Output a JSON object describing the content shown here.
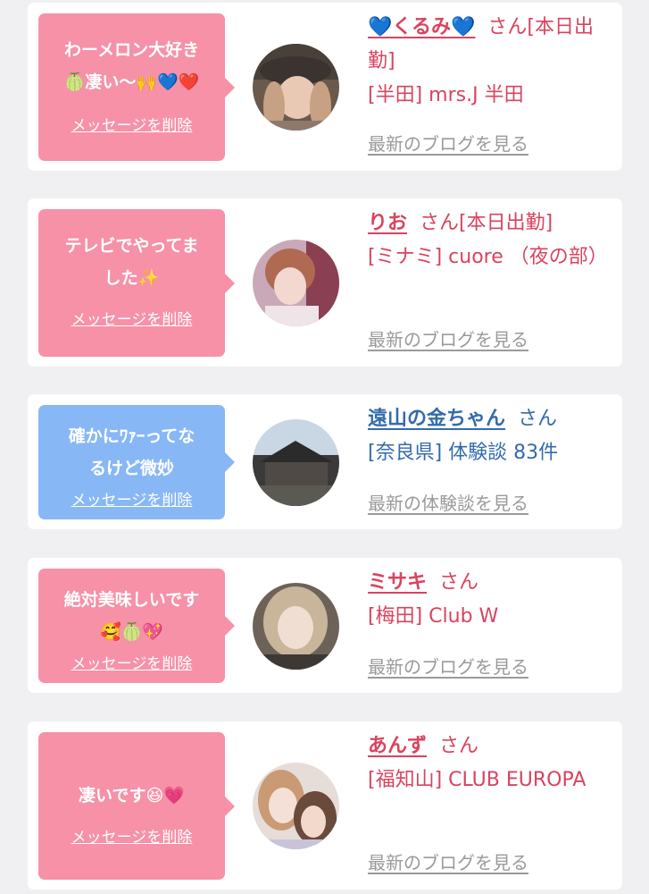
{
  "messages": [
    {
      "bubble_color": "#f691a8",
      "text_line1": "わーメロン大好き",
      "text_line2": "🍈凄い〜🙌💙❤️",
      "delete_label": "メッセージを削除",
      "name": "💙くるみ💙",
      "honorific": "さん",
      "status": "[本日出勤]",
      "shop": "[半田] mrs.J 半田",
      "link_label": "最新のブログを見る"
    },
    {
      "bubble_color": "#f691a8",
      "text_line1": "テレビでやってま",
      "text_line2": "した✨",
      "delete_label": "メッセージを削除",
      "name": "りお",
      "honorific": "さん",
      "status": "[本日出勤]",
      "shop": "[ミナミ] cuore （夜の部）",
      "link_label": "最新のブログを見る"
    },
    {
      "bubble_color": "#88b7f5",
      "text_line1": "確かにﾜｧｰってな",
      "text_line2": "るけど微妙",
      "delete_label": "メッセージを削除",
      "name": "遠山の金ちゃん",
      "honorific": "さん",
      "status": "",
      "shop": "[奈良県] 体験談 83件",
      "link_label": "最新の体験談を見る"
    },
    {
      "bubble_color": "#f691a8",
      "text_line1": "絶対美味しいです",
      "text_line2": "🥰🍈💖",
      "delete_label": "メッセージを削除",
      "name": "ミサキ",
      "honorific": "さん",
      "status": "",
      "shop": "[梅田] Club W",
      "link_label": "最新のブログを見る"
    },
    {
      "bubble_color": "#f691a8",
      "text_line1": "凄いです😆💗",
      "text_line2": "",
      "delete_label": "メッセージを削除",
      "name": "あんず",
      "honorific": "さん",
      "status": "",
      "shop": "[福知山] CLUB EUROPA",
      "link_label": "最新のブログを見る"
    }
  ]
}
